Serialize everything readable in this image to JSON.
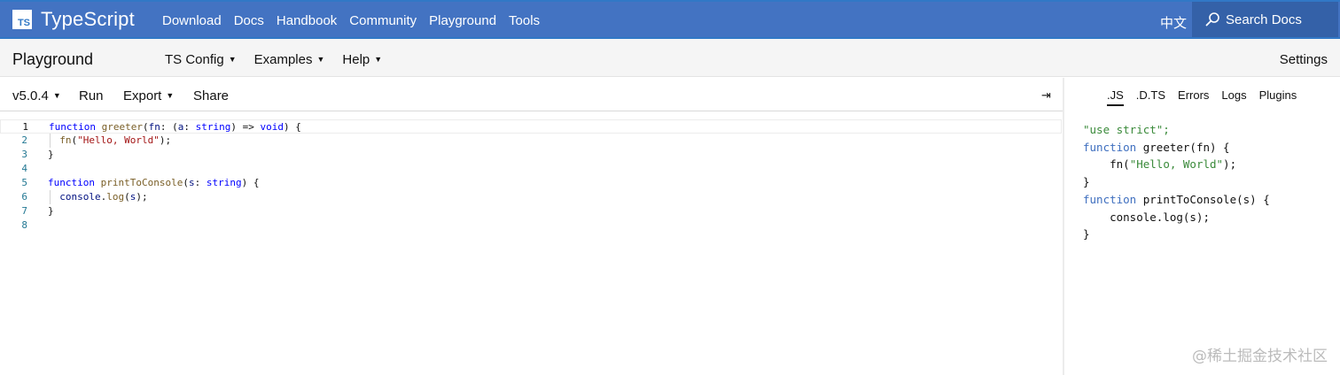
{
  "nav": {
    "logo_badge": "TS",
    "logo_text": "TypeScript",
    "links": [
      "Download",
      "Docs",
      "Handbook",
      "Community",
      "Playground",
      "Tools"
    ],
    "language": "中文",
    "search_label": "Search Docs"
  },
  "subbar": {
    "title": "Playground",
    "menus": [
      "TS Config",
      "Examples",
      "Help"
    ],
    "settings": "Settings"
  },
  "toolbar": {
    "version": "v5.0.4",
    "run": "Run",
    "export": "Export",
    "share": "Share",
    "collapse_icon": "⇥"
  },
  "editor": {
    "line_numbers": [
      "1",
      "2",
      "3",
      "4",
      "5",
      "6",
      "7",
      "8"
    ],
    "lines": [
      "function greeter(fn: (a: string) => void) {",
      "  fn(\"Hello, World\");",
      "}",
      "",
      "function printToConsole(s: string) {",
      "  console.log(s);",
      "}",
      ""
    ]
  },
  "output": {
    "tabs": [
      ".JS",
      ".D.TS",
      "Errors",
      "Logs",
      "Plugins"
    ],
    "active_tab": ".JS",
    "lines": [
      "\"use strict\";",
      "function greeter(fn) {",
      "    fn(\"Hello, World\");",
      "}",
      "function printToConsole(s) {",
      "    console.log(s);",
      "}"
    ]
  },
  "watermark": "@稀土掘金技术社区",
  "colors": {
    "brand": "#3178c6",
    "nav_bg": "#4373c2",
    "search_bg": "#3461a8"
  }
}
